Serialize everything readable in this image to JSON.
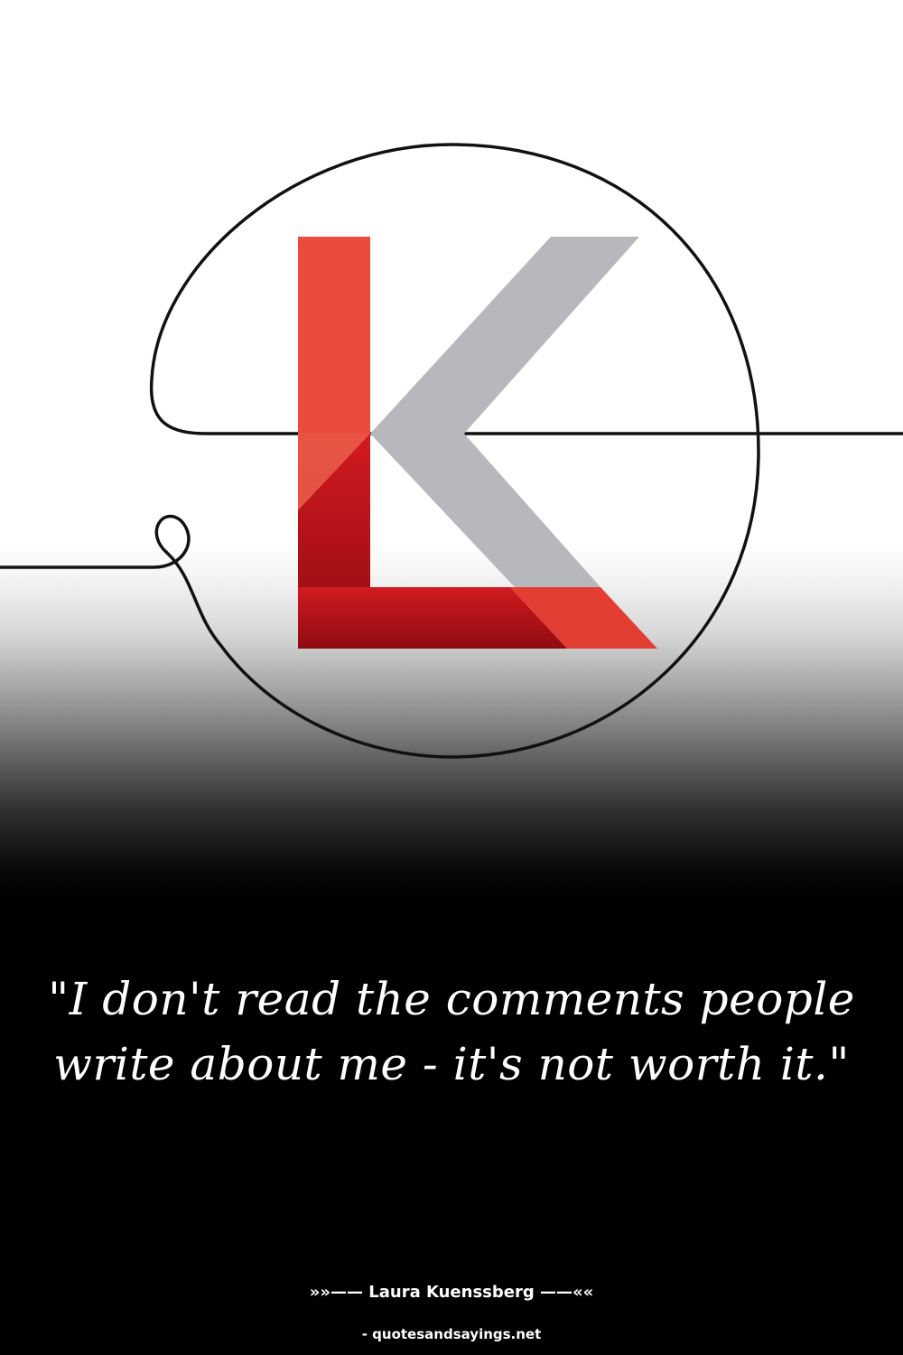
{
  "logo": {
    "name": "LK monogram",
    "letters": "LK",
    "colors": {
      "l_light": "#e94b3c",
      "l_dark": "#b5121b",
      "k_gray": "#b7b8bc",
      "line": "#111111"
    }
  },
  "quote": {
    "text": "\"I don't read the comments people write about me - it's not worth it.\""
  },
  "author": {
    "text": "»»—— Laura Kuenssberg ——««"
  },
  "source": {
    "text": "- quotesandsayings.net"
  }
}
